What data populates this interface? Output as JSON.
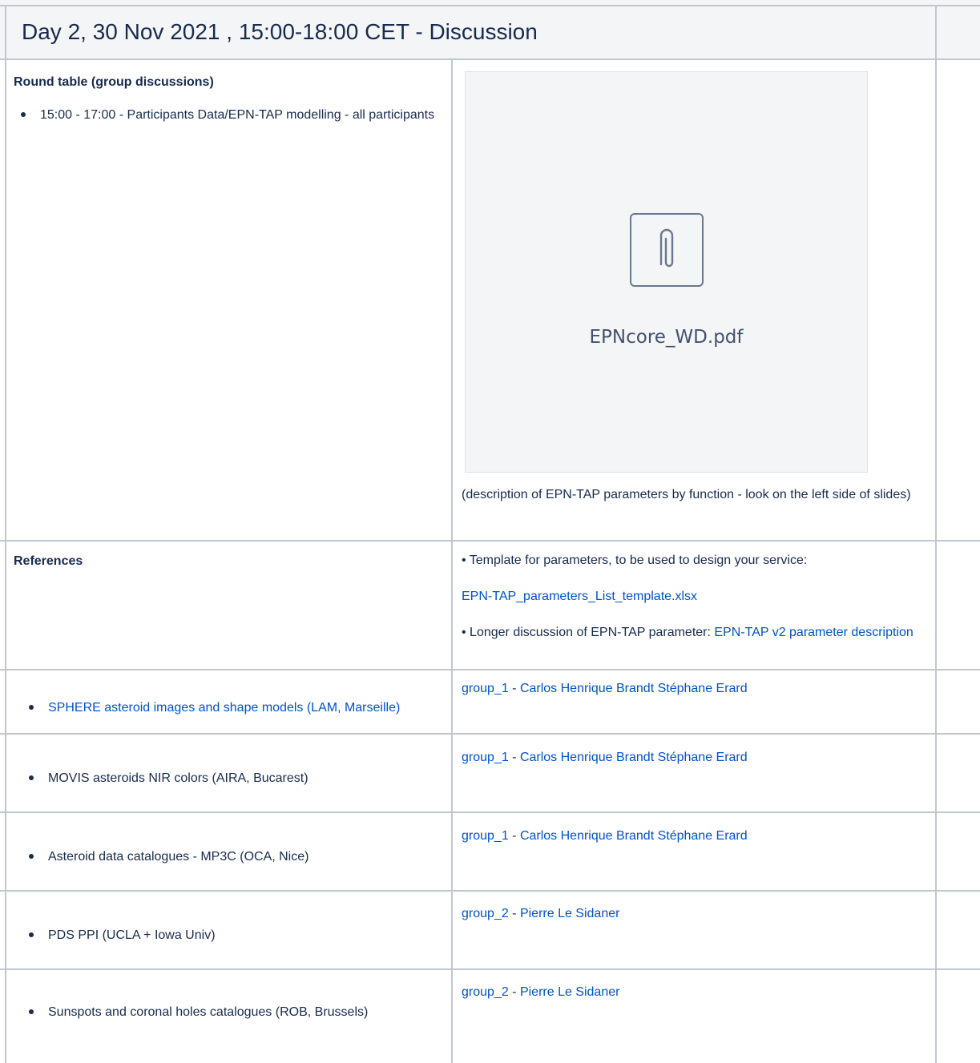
{
  "header": {
    "title": "Day 2, 30 Nov 2021 , 15:00-18:00 CET - Discussion"
  },
  "round_table": {
    "title": "Round table (group discussions)",
    "items": [
      "15:00 - 17:00 - Participants Data/EPN-TAP modelling - all participants"
    ],
    "attachment": {
      "filename": "EPNcore_WD.pdf",
      "icon": "paperclip-icon",
      "caption": "(description of EPN-TAP parameters by function - look on the left side of slides)"
    }
  },
  "references": {
    "label": "References",
    "line1": "• Template for parameters, to be used to design your service:",
    "template_link": "EPN-TAP_parameters_List_template.xlsx",
    "line2_prefix": "• Longer discussion of EPN-TAP parameter: ",
    "line2_link": "EPN-TAP v2 parameter description"
  },
  "rows": [
    {
      "item": "SPHERE asteroid images and shape models (LAM, Marseille)",
      "item_is_link": true,
      "group": "group_1",
      "sep": " - ",
      "people": "Carlos Henrique Brandt Stéphane Erard"
    },
    {
      "item": "MOVIS asteroids NIR colors (AIRA, Bucarest)",
      "item_is_link": false,
      "group": "group_1",
      "sep": " - ",
      "people": "Carlos Henrique Brandt Stéphane Erard"
    },
    {
      "item": "Asteroid data catalogues - MP3C (OCA, Nice)",
      "item_is_link": false,
      "group": "group_1",
      "sep": " - ",
      "people": "Carlos Henrique Brandt  Stéphane Erard"
    },
    {
      "item": "PDS PPI (UCLA + Iowa Univ)",
      "item_is_link": false,
      "group": "group_2",
      "sep": " - ",
      "people": "Pierre Le Sidaner"
    },
    {
      "item": "Sunspots and coronal holes catalogues (ROB, Brussels)",
      "item_is_link": false,
      "group": "group_2",
      "sep": " - ",
      "people": "Pierre Le Sidaner"
    }
  ],
  "colors": {
    "link": "#0052cc",
    "text": "#172b4d",
    "border": "#c1c7d0",
    "header_bg": "#f4f5f7"
  }
}
